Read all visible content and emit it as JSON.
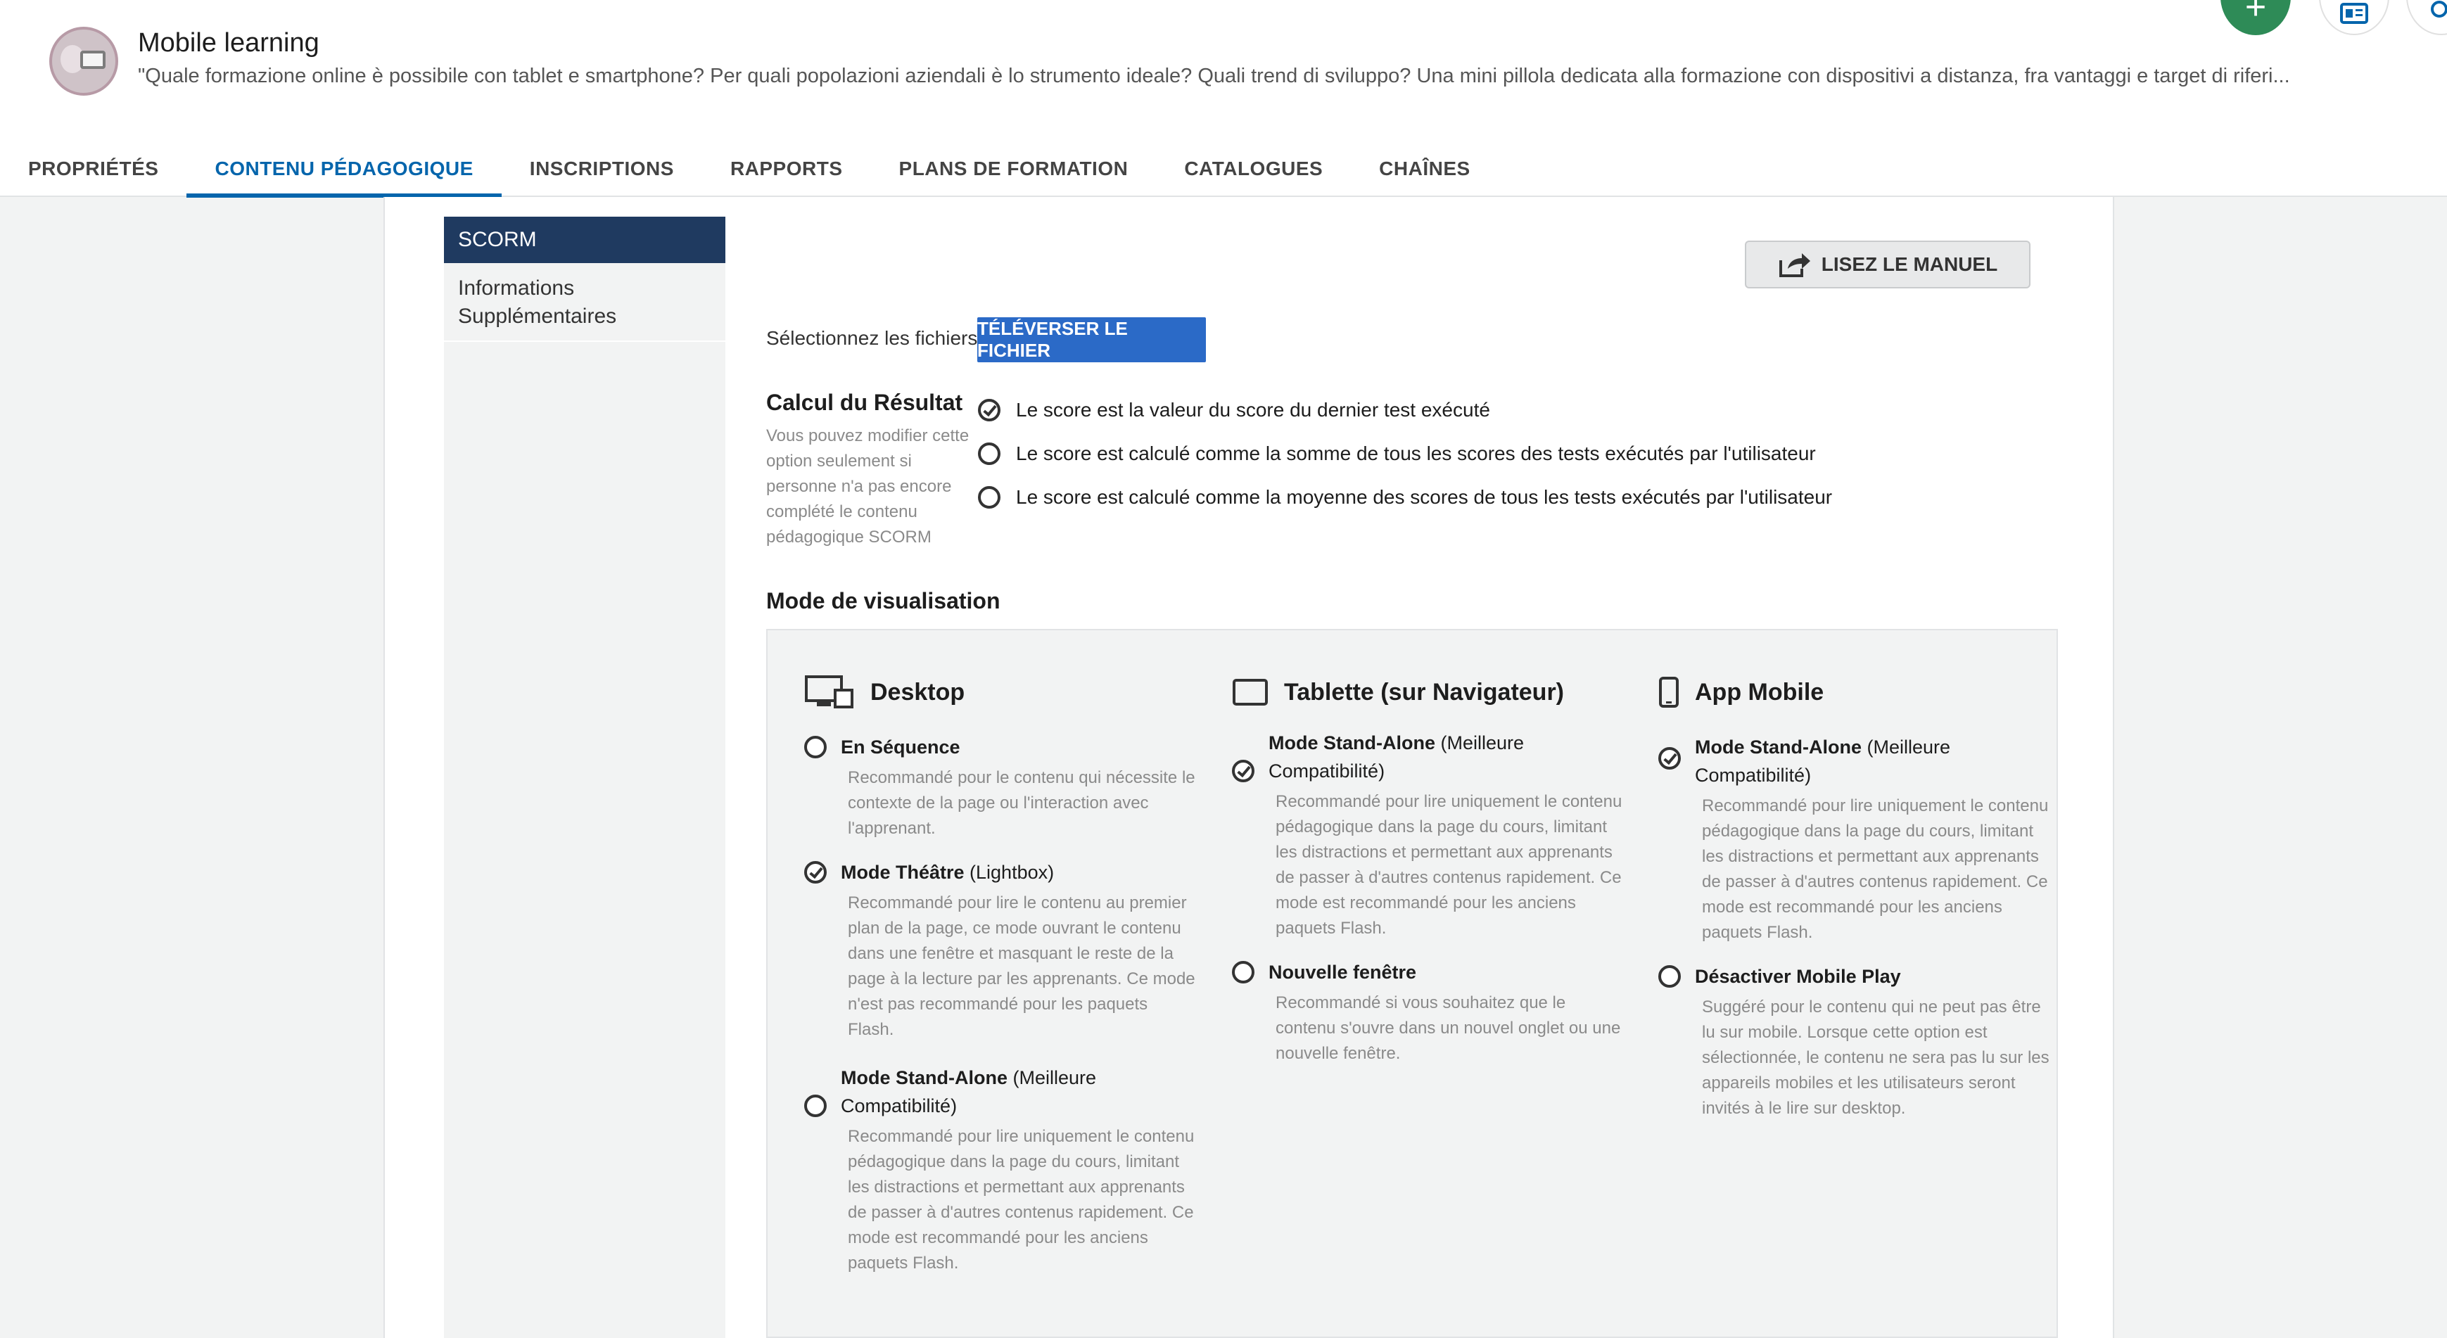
{
  "course": {
    "title": "Mobile learning",
    "description": "\"Quale formazione online è possibile con tablet e smartphone? Per quali popolazioni aziendali è lo strumento ideale? Quali trend di sviluppo? Una mini pillola dedicata alla formazione con dispositivi a distanza, fra vantaggi e target di riferi..."
  },
  "fabs": {
    "add": "+"
  },
  "tabs": [
    {
      "label": "PROPRIÉTÉS"
    },
    {
      "label": "CONTENU PÉDAGOGIQUE"
    },
    {
      "label": "INSCRIPTIONS"
    },
    {
      "label": "RAPPORTS"
    },
    {
      "label": "PLANS DE FORMATION"
    },
    {
      "label": "CATALOGUES"
    },
    {
      "label": "CHAÎNES"
    }
  ],
  "sidenav": [
    {
      "label": "SCORM"
    },
    {
      "label": "Informations Supplémentaires"
    }
  ],
  "manual_button": "LISEZ LE MANUEL",
  "upload": {
    "label": "Sélectionnez les fichiers",
    "button": "TÉLÉVERSER LE FICHIER"
  },
  "calc": {
    "title": "Calcul du Résultat",
    "help": "Vous pouvez modifier cette option seulement si personne n'a pas encore complété le contenu pédagogique SCORM",
    "options": [
      {
        "label": "Le score est la valeur du score du dernier test exécuté",
        "checked": true
      },
      {
        "label": "Le score est calculé comme la somme de tous les scores des tests exécutés par l'utilisateur",
        "checked": false
      },
      {
        "label": "Le score est calculé comme la moyenne des scores de tous les tests exécutés par l'utilisateur",
        "checked": false
      }
    ]
  },
  "mode": {
    "title": "Mode de visualisation",
    "desktop": {
      "heading": "Desktop",
      "options": [
        {
          "name": "En Séquence",
          "suffix": "",
          "desc": "Recommandé pour le contenu qui nécessite le contexte de la page ou l'interaction avec l'apprenant.",
          "checked": false
        },
        {
          "name": "Mode Théâtre",
          "suffix": " (Lightbox)",
          "desc": "Recommandé pour lire le contenu au premier plan de la page, ce mode ouvrant le contenu dans une fenêtre et masquant le reste de la page à la lecture par les apprenants. Ce mode n'est pas recommandé pour les paquets Flash.",
          "checked": true
        },
        {
          "name": "Mode Stand-Alone",
          "suffix": " (Meilleure Compatibilité)",
          "desc": "Recommandé pour lire uniquement le contenu pédagogique dans la page du cours, limitant les distractions et permettant aux apprenants de passer à d'autres contenus rapidement. Ce mode est recommandé pour les anciens paquets Flash.",
          "checked": false
        }
      ]
    },
    "tablet": {
      "heading": "Tablette (sur Navigateur)",
      "options": [
        {
          "name": "Mode Stand-Alone",
          "suffix": " (Meilleure Compatibilité)",
          "desc": "Recommandé pour lire uniquement le contenu pédagogique dans la page du cours, limitant les distractions et permettant aux apprenants de passer à d'autres contenus rapidement. Ce mode est recommandé pour les anciens paquets Flash.",
          "checked": true
        },
        {
          "name": "Nouvelle fenêtre",
          "suffix": "",
          "desc": "Recommandé si vous souhaitez que le contenu s'ouvre dans un nouvel onglet ou une nouvelle fenêtre.",
          "checked": false
        }
      ]
    },
    "mobile": {
      "heading": "App Mobile",
      "options": [
        {
          "name": "Mode Stand-Alone",
          "suffix": " (Meilleure Compatibilité)",
          "desc": "Recommandé pour lire uniquement le contenu pédagogique dans la page du cours, limitant les distractions et permettant aux apprenants de passer à d'autres contenus rapidement. Ce mode est recommandé pour les anciens paquets Flash.",
          "checked": true
        },
        {
          "name": "Désactiver Mobile Play",
          "suffix": "",
          "desc": "Suggéré pour le contenu qui ne peut pas être lu sur mobile. Lorsque cette option est sélectionnée, le contenu ne sera pas lu sur les appareils mobiles et les utilisateurs seront invités à le lire sur desktop.",
          "checked": false
        }
      ]
    }
  }
}
